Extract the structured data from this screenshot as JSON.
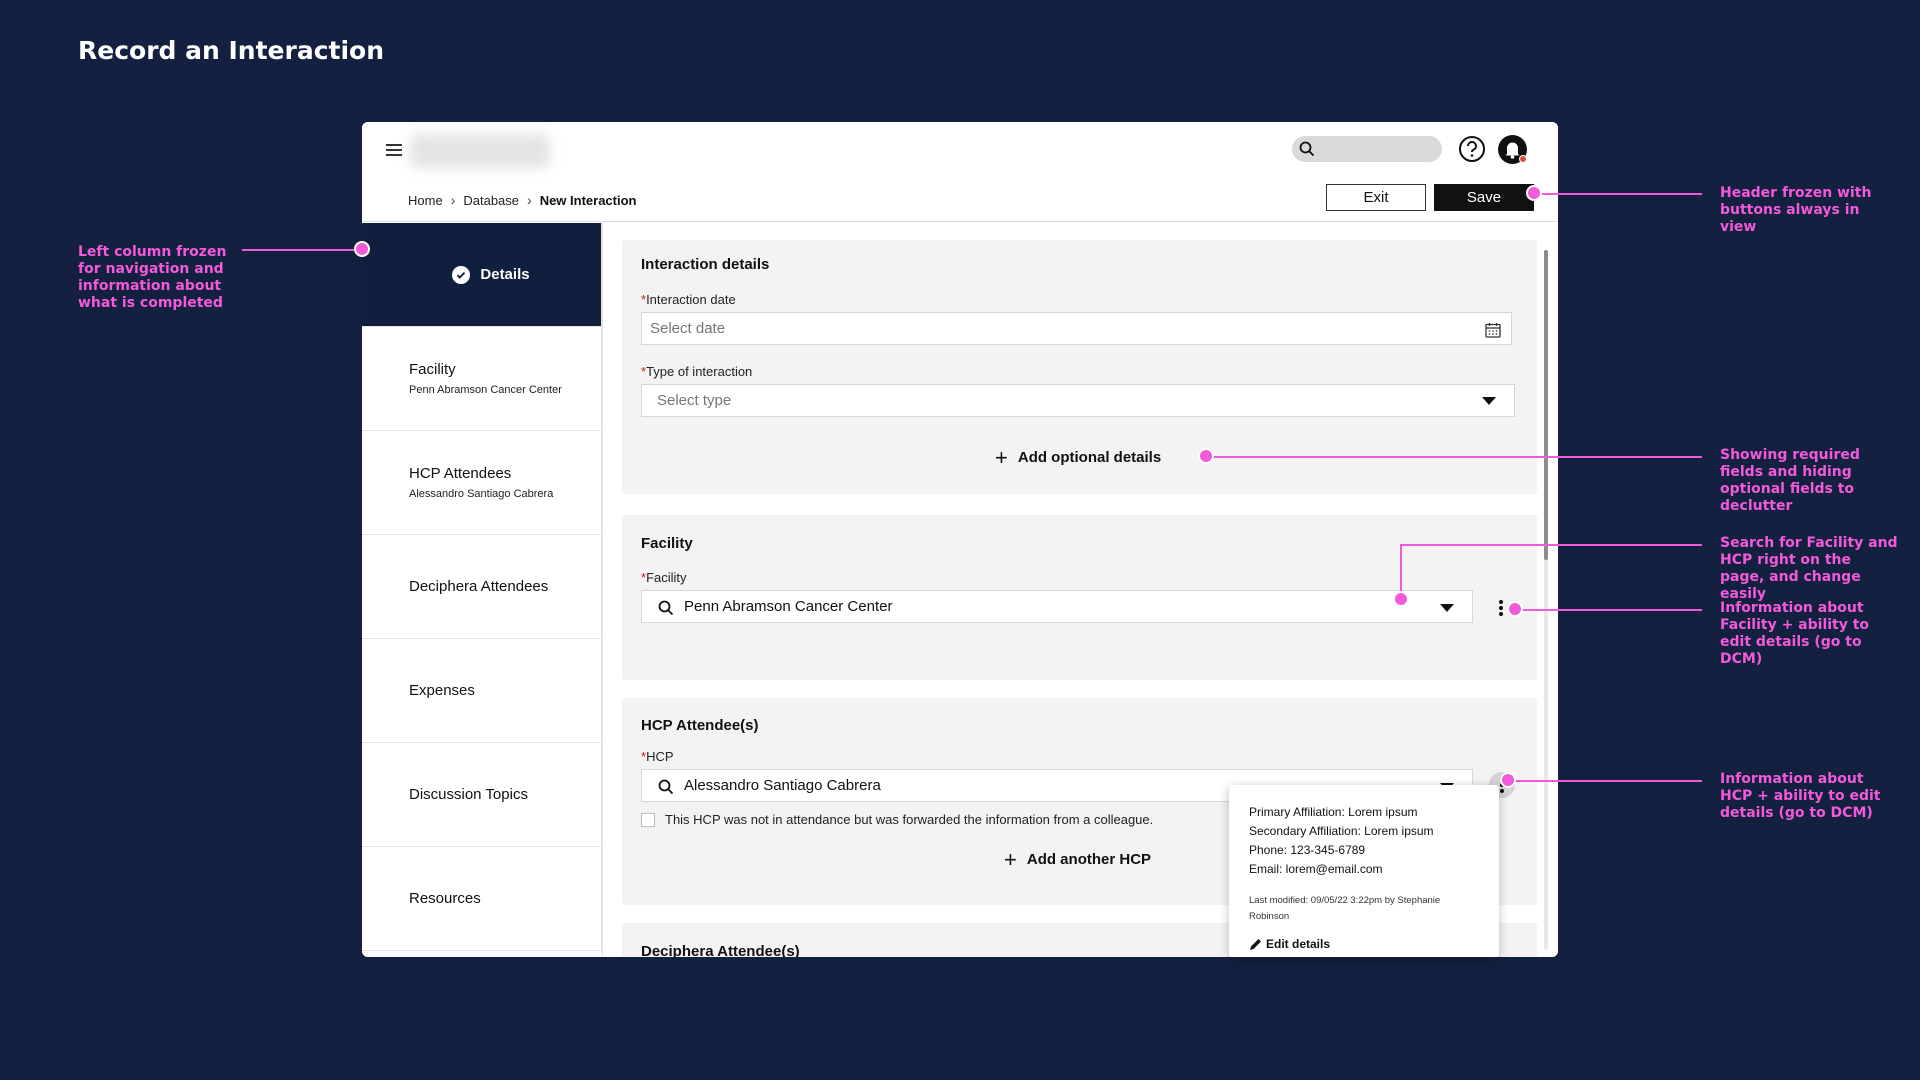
{
  "page_title": "Record an Interaction",
  "colors": {
    "background": "#13203f",
    "accent": "#f25ad9",
    "nav_active": "#0f1f3d"
  },
  "header": {
    "icons": [
      "menu-icon",
      "search-icon",
      "help-icon",
      "notifications-icon"
    ],
    "breadcrumb": [
      "Home",
      "Database",
      "New Interaction"
    ],
    "exit_label": "Exit",
    "save_label": "Save"
  },
  "sidebar": {
    "items": [
      {
        "label": "Details",
        "sub": "",
        "active": true
      },
      {
        "label": "Facility",
        "sub": "Penn Abramson Cancer Center"
      },
      {
        "label": "HCP Attendees",
        "sub": "Alessandro Santiago Cabrera"
      },
      {
        "label": "Deciphera Attendees",
        "sub": ""
      },
      {
        "label": "Expenses",
        "sub": ""
      },
      {
        "label": "Discussion Topics",
        "sub": ""
      },
      {
        "label": "Resources",
        "sub": ""
      }
    ]
  },
  "interaction": {
    "title": "Interaction details",
    "required_mark": "*",
    "date_label": "Interaction date",
    "date_placeholder": "Select date",
    "type_label": "Type of interaction",
    "type_placeholder": "Select type",
    "add_optional": "Add optional details"
  },
  "facility": {
    "title": "Facility",
    "field_label": "Facility",
    "value": "Penn Abramson Cancer Center"
  },
  "hcp": {
    "title": "HCP Attendee(s)",
    "field_label": "HCP",
    "value": "Alessandro Santiago Cabrera",
    "checkbox_label": "This HCP was not in attendance but was forwarded the information from a colleague.",
    "add_another": "Add another HCP"
  },
  "deciphera": {
    "title": "Deciphera Attendee(s)"
  },
  "popover": {
    "primary": "Primary Affiliation: Lorem ipsum",
    "secondary": "Secondary Affiliation: Lorem ipsum",
    "phone": "Phone: 123-345-6789",
    "email": "Email: lorem@email.com",
    "modified": "Last modified: 09/05/22 3:22pm by Stephanie Robinson",
    "edit": "Edit details"
  },
  "annotations": {
    "left_column": "Left column frozen for navigation and information about what is completed",
    "header": "Header frozen with buttons always in view",
    "required_fields": "Showing required fields and hiding optional fields to declutter",
    "search": "Search for Facility and HCP right on the page, and change easily",
    "facility_info": "Information about Facility + ability to edit details (go to DCM)",
    "hcp_info": "Information about HCP + ability to edit details (go to DCM)"
  }
}
